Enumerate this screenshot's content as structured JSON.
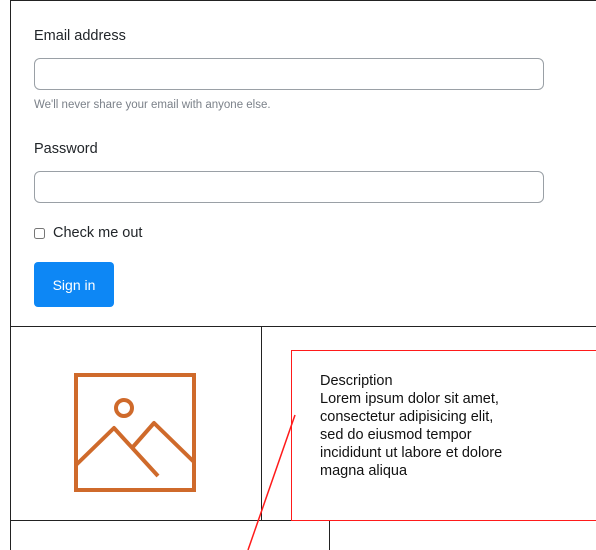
{
  "form": {
    "email_label": "Email address",
    "email_value": "",
    "email_placeholder": "",
    "email_help": "We'll never share your email with anyone else.",
    "password_label": "Password",
    "password_value": "",
    "password_placeholder": "",
    "checkbox_label": "Check me out",
    "checkbox_checked": false,
    "submit_label": "Sign in",
    "submit_color": "#0d87f5"
  },
  "card": {
    "image_icon": "image-placeholder-icon",
    "image_icon_color": "#cf6a2b",
    "description_title": "Description",
    "description_lines": [
      "Lorem ipsum dolor sit amet,",
      "consectetur adipisicing elit,",
      "sed do eiusmod tempor",
      "incididunt ut labore et dolore",
      "magna aliqua"
    ],
    "highlight_color": "#ff1a1a"
  }
}
